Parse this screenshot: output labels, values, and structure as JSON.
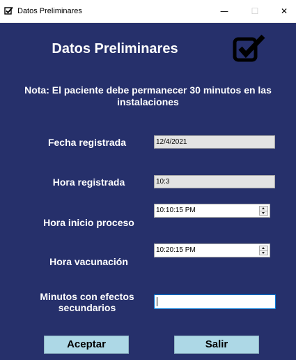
{
  "window": {
    "title": "Datos Preliminares",
    "controls": {
      "minimize": "—",
      "maximize": "☐",
      "close": "✕"
    }
  },
  "form": {
    "heading": "Datos Preliminares",
    "note": "Nota: El paciente debe permanecer 30 minutos en las instalaciones",
    "fecha_registrada": {
      "label": "Fecha registrada",
      "value": "12/4/2021"
    },
    "hora_registrada": {
      "label": "Hora registrada",
      "value": "10:3"
    },
    "hora_inicio": {
      "label": "Hora inicio proceso",
      "value": "10:10:15 PM"
    },
    "hora_vacunacion": {
      "label": "Hora vacunación",
      "value": "10:20:15 PM"
    },
    "minutos_efectos": {
      "label": "Minutos con efectos secundarios",
      "value": ""
    },
    "buttons": {
      "accept": "Aceptar",
      "exit": "Salir"
    }
  },
  "colors": {
    "background": "#26306b",
    "button": "#add8e6",
    "readonly_field": "#e3e3e3"
  },
  "icons": {
    "form_icon": "checkbox-checked-icon"
  }
}
